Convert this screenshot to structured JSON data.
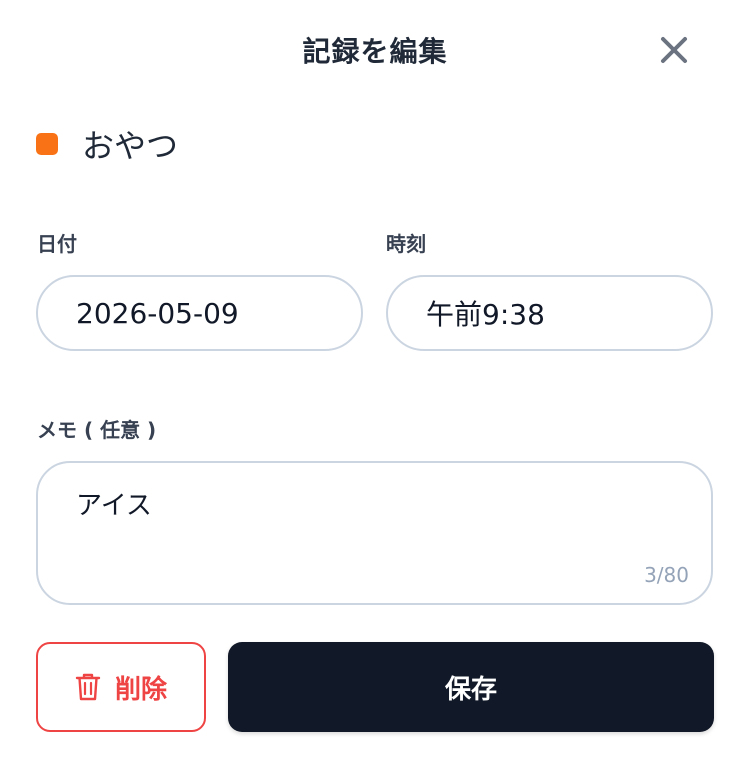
{
  "header": {
    "title": "記録を編集",
    "close_icon": "close-icon"
  },
  "category": {
    "label": "おやつ",
    "color": "#f97316"
  },
  "date_field": {
    "label": "日付",
    "value": "2026-05-09"
  },
  "time_field": {
    "label": "時刻",
    "value": "午前9:38"
  },
  "memo_field": {
    "label": "メモ ( 任意 )",
    "value": "アイス",
    "counter": "3/80"
  },
  "actions": {
    "delete_label": "削除",
    "delete_icon": "trash-icon",
    "save_label": "保存"
  },
  "colors": {
    "accent_dark": "#111827",
    "danger": "#ef4444",
    "border": "#cbd5e1"
  }
}
